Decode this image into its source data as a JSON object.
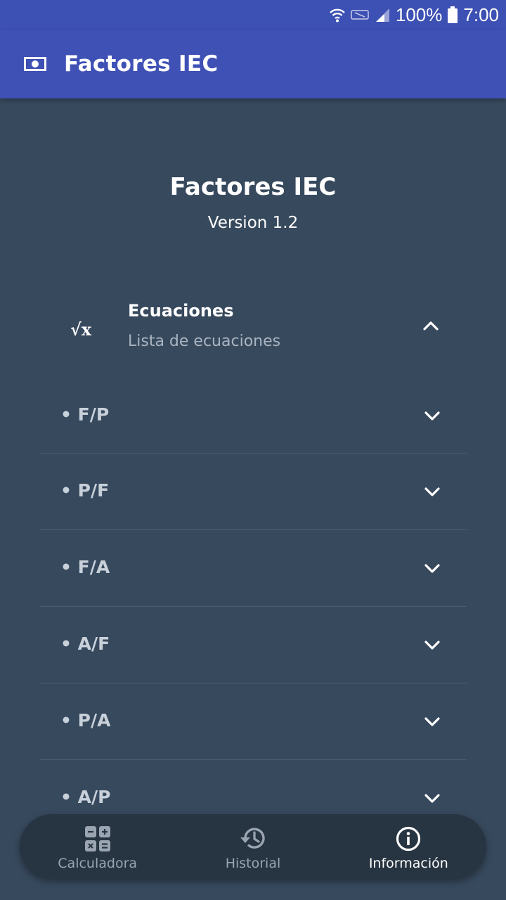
{
  "status_bar": {
    "battery": "100%",
    "time": "7:00"
  },
  "app_bar": {
    "title": "Factores IEC",
    "icon": "money-icon"
  },
  "about": {
    "title": "Factores IEC",
    "version": "Version 1.2"
  },
  "section": {
    "icon": "square-root-icon",
    "icon_glyph": "√x",
    "title": "Ecuaciones",
    "subtitle": "Lista de ecuaciones"
  },
  "equations": [
    {
      "label": "• F/P"
    },
    {
      "label": "• P/F"
    },
    {
      "label": "• F/A"
    },
    {
      "label": "• A/F"
    },
    {
      "label": "• P/A"
    },
    {
      "label": "• A/P"
    }
  ],
  "bottom_nav": {
    "items": [
      {
        "label": "Calculadora",
        "icon": "calculator-icon"
      },
      {
        "label": "Historial",
        "icon": "history-icon"
      },
      {
        "label": "Información",
        "icon": "info-icon",
        "active": true
      }
    ]
  },
  "colors": {
    "app_bar": "#3f51b5",
    "background": "#37495d",
    "bottom_nav": "#273441"
  }
}
